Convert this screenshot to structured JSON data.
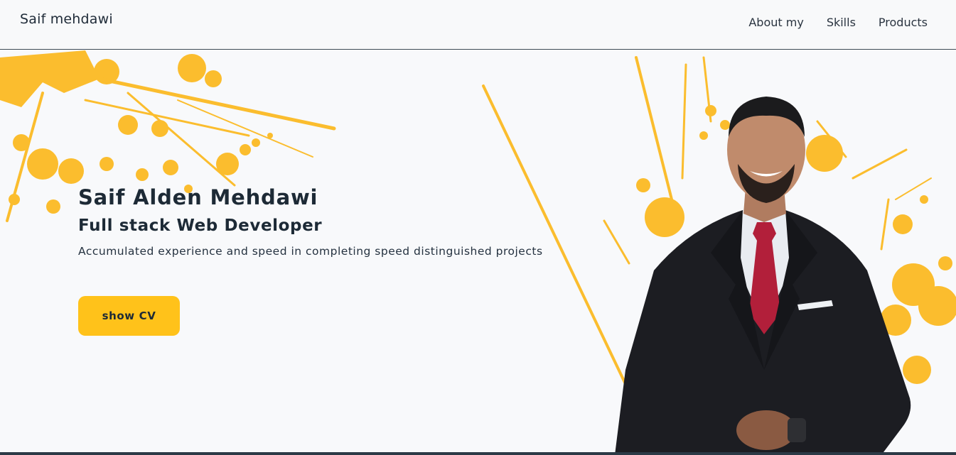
{
  "navbar": {
    "brand": "Saif mehdawi",
    "links": [
      "About my",
      "Skills",
      "Products"
    ]
  },
  "hero": {
    "name": "Saif Alden Mehdawi",
    "role": "Full stack Web Developer",
    "description": "Accumulated experience and speed in completing speed distinguished projects",
    "cta_label": "show CV"
  },
  "colors": {
    "accent": "#ffc21a",
    "splash": "#fbbd2e",
    "text": "#1d2a36",
    "background": "#f8f9fb"
  }
}
